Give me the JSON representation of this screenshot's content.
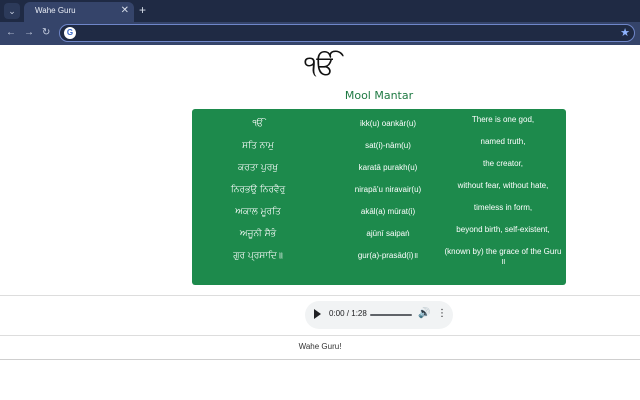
{
  "browser": {
    "tab_title": "Wahe Guru",
    "tab_close_icon": "close-icon",
    "new_tab_icon": "plus-icon",
    "menu_icon": "chevron-down-icon",
    "nav_icons": [
      "back-icon",
      "forward-icon",
      "reload-icon"
    ],
    "address_value": "",
    "search_engine_icon": "google-g-icon",
    "bookmark_icon": "star-icon",
    "colors": {
      "tabbar": "#1f2a44",
      "toolbar": "#35446a",
      "omnibox_border": "#6f86c9"
    }
  },
  "page": {
    "ik_onkar": "ੴ",
    "title": "Mool Mantar",
    "rows": [
      {
        "gurmukhi": "ੴ",
        "translit": "ikk(u) oankār(u)",
        "english": "There is one god,"
      },
      {
        "gurmukhi": "ਸਤਿ ਨਾਮੁ",
        "translit": "sat(i)-nām(u)",
        "english": "named truth,"
      },
      {
        "gurmukhi": "ਕਰਤਾ ਪੁਰਖੁ",
        "translit": "karatā purakh(u)",
        "english": "the creator,"
      },
      {
        "gurmukhi": "ਨਿਰਭਉ ਨਿਰਵੈਰੁ",
        "translit": "nirapā'u niravair(u)",
        "english": "without fear, without hate,"
      },
      {
        "gurmukhi": "ਅਕਾਲ ਮੂਰਤਿ",
        "translit": "akāl(a) mūrat(i)",
        "english": "timeless in form,"
      },
      {
        "gurmukhi": "ਅਜੂਨੀ ਸੈਭੰ",
        "translit": "ajūnī saipaṅ",
        "english": "beyond birth, self-existent,"
      },
      {
        "gurmukhi": "ਗੁਰ ਪ੍ਰਸਾਦਿ॥",
        "translit": "gur(a)-prasād(i)॥",
        "english": "(known by) the grace of the Guru ॥"
      }
    ],
    "colors": {
      "card": "#1d8a4c",
      "title": "#1f7a43"
    }
  },
  "audio": {
    "time": "0:00 / 1:28",
    "play_icon": "play-icon",
    "volume_icon": "volume-icon",
    "more_icon": "more-vertical-icon"
  },
  "footer": {
    "text": "Wahe Guru!"
  }
}
